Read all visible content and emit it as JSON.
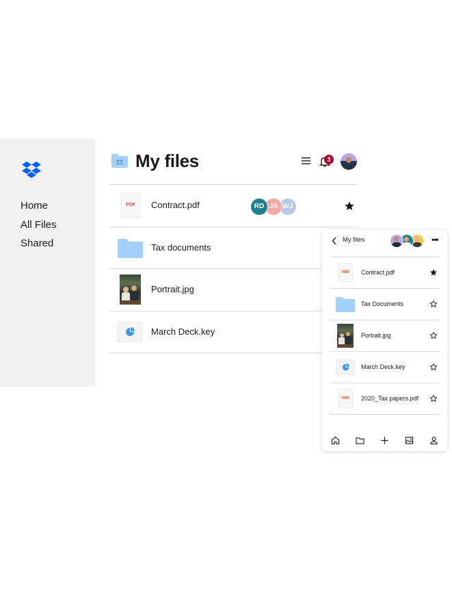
{
  "sidebar": {
    "logo": "dropbox-logo",
    "nav": [
      {
        "label": "Home"
      },
      {
        "label": "All Files"
      },
      {
        "label": "Shared"
      }
    ]
  },
  "header": {
    "title": "My files",
    "title_icon": "shared-folder-icon",
    "notification_count": "3"
  },
  "files": [
    {
      "name": "Contract.pdf",
      "type": "pdf",
      "thumb_label": "PDF",
      "collaborators": [
        {
          "initials": "RD",
          "color": "#1a7f8e"
        },
        {
          "initials": "JA",
          "color": "#f7a8a0"
        },
        {
          "initials": "WJ",
          "color": "#b5c8e6"
        }
      ],
      "starred": true
    },
    {
      "name": "Tax documents",
      "type": "folder"
    },
    {
      "name": "Portrait.jpg",
      "type": "image"
    },
    {
      "name": "March Deck.key",
      "type": "keynote"
    }
  ],
  "mobile_panel": {
    "title": "My files",
    "items": [
      {
        "name": "Contract.pdf",
        "type": "pdf",
        "thumb_label": "PDF",
        "starred": true
      },
      {
        "name": "Tax Documents",
        "type": "folder",
        "starred": false
      },
      {
        "name": "Portrait.jpg",
        "type": "image",
        "starred": false
      },
      {
        "name": "March Deck.key",
        "type": "keynote",
        "starred": false
      },
      {
        "name": "2020_Tax papers.pdf",
        "type": "pdf",
        "thumb_label": "PDF",
        "starred": false
      }
    ],
    "tabs": [
      "home-icon",
      "folder-icon",
      "plus-icon",
      "photos-icon",
      "account-icon"
    ]
  },
  "colors": {
    "sidebar_bg": "#f1f1f1",
    "brand_blue": "#0061fe",
    "folder_blue": "#a4d1fc",
    "pdf_red": "#f25533",
    "badge": "#b4002c"
  }
}
